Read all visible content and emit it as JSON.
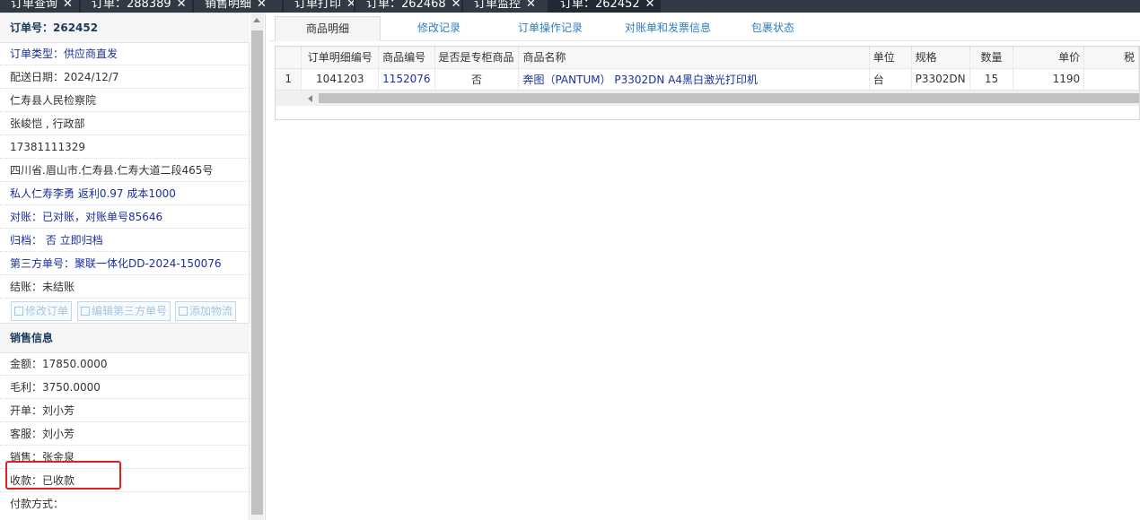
{
  "top_tabs": [
    {
      "label": "订单查询"
    },
    {
      "label": "订单：288389"
    },
    {
      "label": "销售明细"
    },
    {
      "label": "订单打印"
    },
    {
      "label": "订单：262468"
    },
    {
      "label": "订单监控"
    },
    {
      "label": "订单：262452"
    }
  ],
  "left": {
    "order_header": "订单号：262452",
    "rows": [
      "订单类型：供应商直发",
      "配送日期：2024/12/7",
      "仁寿县人民检察院",
      "张峻恺 , 行政部",
      "17381111329",
      "四川省.眉山市.仁寿县.仁寿大道二段465号",
      "私人仁寿李勇 返利0.97 成本1000",
      "对账：已对账，对账单号85646",
      "归档： 否 立即归档",
      "第三方单号：聚联一体化DD-2024-150076",
      "结账：未结账"
    ],
    "buttons": {
      "edit_order": "修改订单",
      "edit_third_party": "编辑第三方单号",
      "add_logistics": "添加物流"
    },
    "sales_header": "销售信息",
    "sales_rows": [
      "金额：17850.0000",
      "毛利：3750.0000",
      "开单：刘小芳",
      "客服：刘小芳",
      "销售：张金泉",
      "收款：已收款",
      "付款方式："
    ]
  },
  "right": {
    "tabs": [
      "商品明细",
      "修改记录",
      "订单操作记录",
      "对账单和发票信息",
      "包裹状态"
    ],
    "grid": {
      "headers": [
        "订单明细编号",
        "商品编号",
        "是否是专柜商品",
        "商品名称",
        "单位",
        "规格",
        "数量",
        "单价",
        "税"
      ],
      "rows": [
        {
          "row_number": "1",
          "detail_id": "1041203",
          "product_id": "1152076",
          "is_counter": "否",
          "product_name": "奔图（PANTUM） P3302DN A4黑白激光打印机",
          "unit": "台",
          "spec": "P3302DN",
          "qty": "15",
          "price": "1190",
          "tax": ""
        }
      ]
    }
  },
  "colors": {
    "topbar": "#2f3a45",
    "link_blue": "#1a2f9b",
    "tab_blue": "#2e7dc1",
    "highlight_red": "#e02020"
  }
}
